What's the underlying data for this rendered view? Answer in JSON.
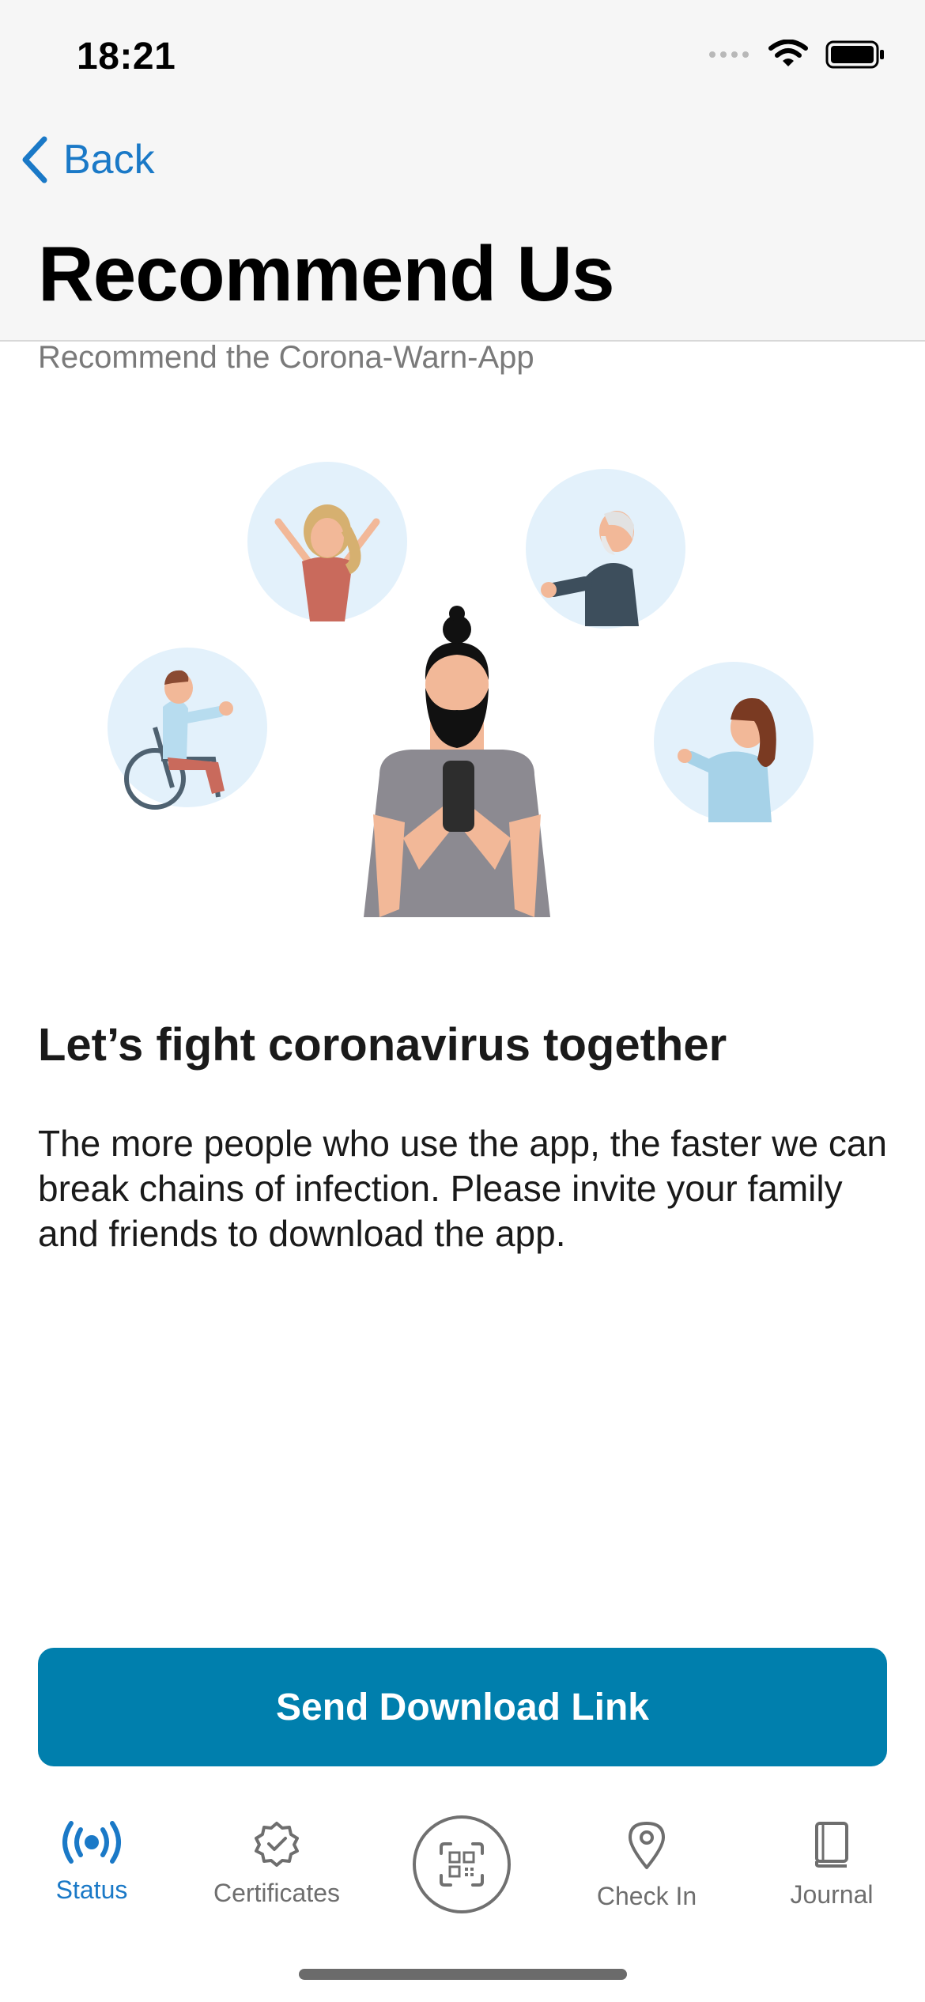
{
  "status_bar": {
    "time": "18:21"
  },
  "nav": {
    "back_label": "Back",
    "title": "Recommend Us",
    "subtitle": "Recommend the Corona-Warn-App"
  },
  "content": {
    "heading": "Let’s fight coronavirus together",
    "body": "The more people who use the app, the faster we can break chains of infection. Please invite your family and friends to download the app."
  },
  "actions": {
    "send_link_label": "Send Download Link"
  },
  "tabbar": {
    "tabs": [
      {
        "label": "Status",
        "icon": "broadcast-icon",
        "active": true
      },
      {
        "label": "Certificates",
        "icon": "certificate-badge-icon",
        "active": false
      },
      {
        "label": "",
        "icon": "qr-scan-icon",
        "active": false
      },
      {
        "label": "Check In",
        "icon": "location-pin-icon",
        "active": false
      },
      {
        "label": "Journal",
        "icon": "book-icon",
        "active": false
      }
    ]
  },
  "colors": {
    "accent": "#007fad",
    "link": "#1a79c7",
    "header_bg": "#f6f6f6",
    "illustration_circle": "#e3f1fb"
  }
}
